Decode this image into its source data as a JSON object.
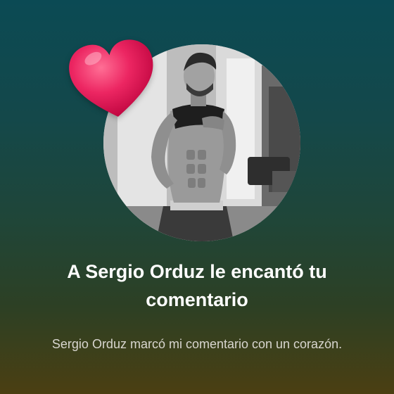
{
  "notification": {
    "title": "A Sergio Orduz le encantó tu comentario",
    "subtitle": "Sergio Orduz marcó mi comentario con un corazón.",
    "reaction_icon": "heart-icon",
    "reaction_color": "#e8195c"
  },
  "colors": {
    "background_top": "#0b4a54",
    "background_bottom": "#4b3f12",
    "title_text": "#ffffff",
    "subtitle_text": "#d8d6cf"
  }
}
